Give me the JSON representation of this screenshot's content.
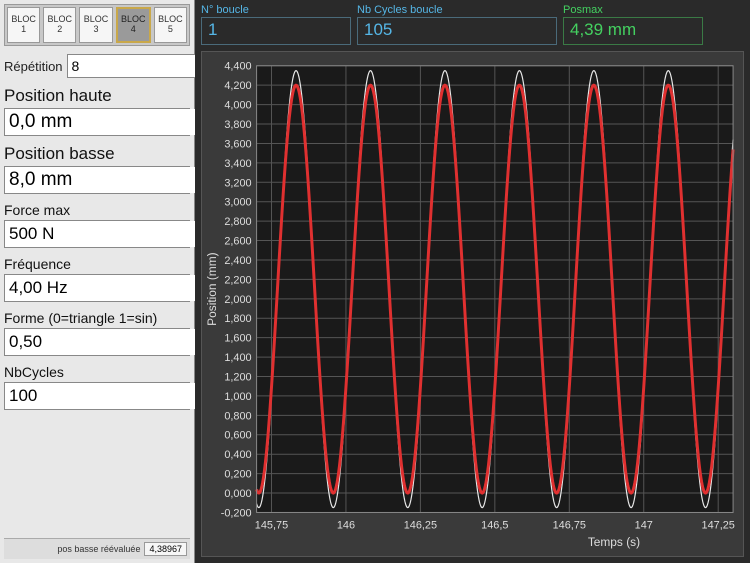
{
  "blocs": [
    {
      "line1": "BLOC",
      "line2": "1"
    },
    {
      "line1": "BLOC",
      "line2": "2"
    },
    {
      "line1": "BLOC",
      "line2": "3"
    },
    {
      "line1": "BLOC",
      "line2": "4"
    },
    {
      "line1": "BLOC",
      "line2": "5"
    }
  ],
  "bloc_selected": 3,
  "repetition": {
    "label": "Répétition",
    "value": "8"
  },
  "params": [
    {
      "label": "Position haute",
      "value": "0,0 mm",
      "big": true
    },
    {
      "label": "Position basse",
      "value": "8,0 mm",
      "big": true
    },
    {
      "label": "Force max",
      "value": "500 N",
      "big": false
    },
    {
      "label": "Fréquence",
      "value": "4,00 Hz",
      "big": false
    },
    {
      "label": "Forme (0=triangle 1=sin)",
      "value": "0,50",
      "big": false
    },
    {
      "label": "NbCycles",
      "value": "100",
      "big": false
    }
  ],
  "footer": {
    "label": "pos basse réévaluée",
    "value": "4,38967"
  },
  "header": {
    "boucle": {
      "label": "N° boucle",
      "value": "1"
    },
    "cycles": {
      "label": "Nb Cycles boucle",
      "value": "105"
    },
    "posmax": {
      "label": "Posmax",
      "value": "4,39 mm"
    }
  },
  "chart_data": {
    "type": "line",
    "xlabel": "Temps (s)",
    "ylabel": "Position (mm)",
    "xlim": [
      145.7,
      147.3
    ],
    "ylim": [
      -0.2,
      4.4
    ],
    "xticks": [
      145.75,
      146,
      146.25,
      146.5,
      146.75,
      147,
      147.25
    ],
    "yticks": [
      -0.2,
      0.0,
      0.2,
      0.4,
      0.6,
      0.8,
      1.0,
      1.2,
      1.4,
      1.6,
      1.8,
      2.0,
      2.2,
      2.4,
      2.6,
      2.8,
      3.0,
      3.2,
      3.4,
      3.6,
      3.8,
      4.0,
      4.2,
      4.4
    ],
    "series": [
      {
        "name": "white",
        "color": "#e8e8e8",
        "frequency_hz": 4.0,
        "amp": 2.25,
        "offset": 2.1,
        "phase_s": 145.77
      },
      {
        "name": "red",
        "color": "#e03030",
        "frequency_hz": 4.0,
        "amp": 2.1,
        "offset": 2.1,
        "phase_s": 145.77
      }
    ]
  }
}
